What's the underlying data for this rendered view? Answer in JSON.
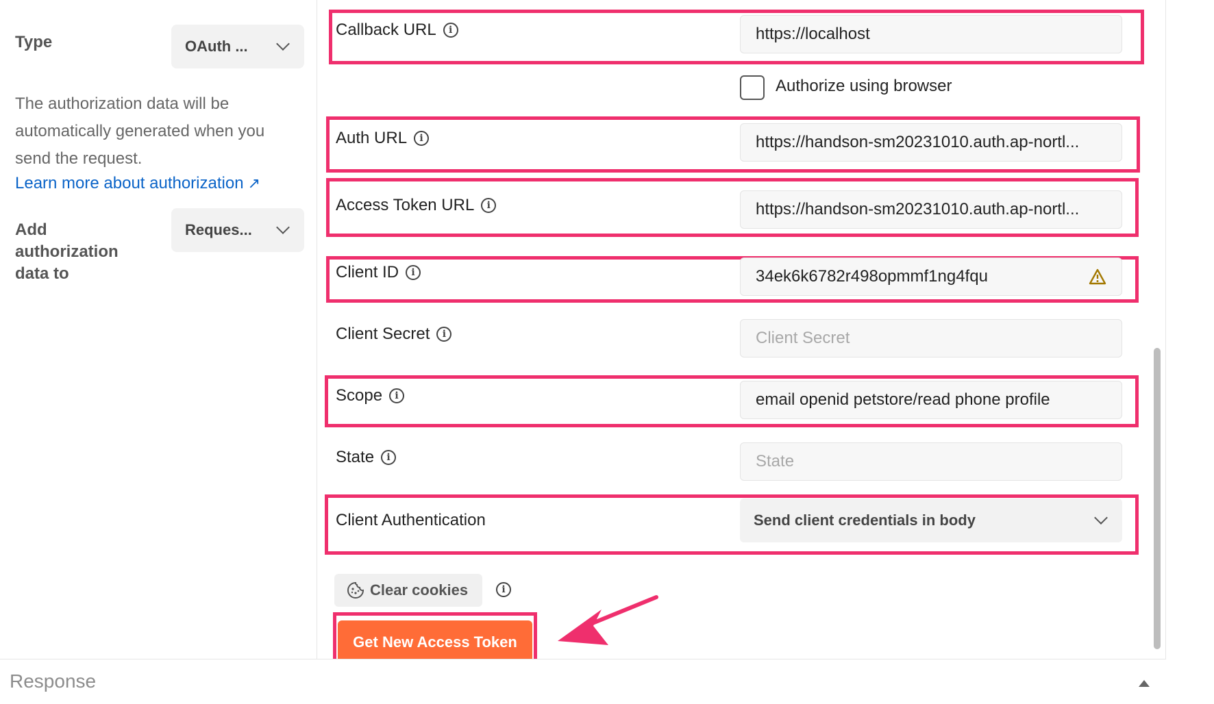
{
  "left": {
    "type_label": "Type",
    "type_value": "OAuth ...",
    "description": "The authorization data will be automatically generated when you send the request.",
    "learn_more": "Learn more about authorization",
    "learn_more_arrow": "↗",
    "add_label": "Add authorization data to",
    "add_value": "Reques..."
  },
  "fields": {
    "callback_url": {
      "label": "Callback URL",
      "value": "https://localhost"
    },
    "authorize_browser": "Authorize using browser",
    "auth_url": {
      "label": "Auth URL",
      "value": "https://handson-sm20231010.auth.ap-nortl..."
    },
    "access_token_url": {
      "label": "Access Token URL",
      "value": "https://handson-sm20231010.auth.ap-nortl..."
    },
    "client_id": {
      "label": "Client ID",
      "value": "34ek6k6782r498opmmf1ng4fqu"
    },
    "client_secret": {
      "label": "Client Secret",
      "placeholder": "Client Secret"
    },
    "scope": {
      "label": "Scope",
      "value": "email openid petstore/read phone profile"
    },
    "state": {
      "label": "State",
      "placeholder": "State"
    },
    "client_auth": {
      "label": "Client Authentication",
      "value": "Send client credentials in body"
    }
  },
  "actions": {
    "clear_cookies": "Clear cookies",
    "get_token": "Get New Access Token"
  },
  "bottom": {
    "response": "Response"
  },
  "colors": {
    "highlight": "#ef2f6d",
    "primary": "#ff6c37",
    "link": "#0b64c8"
  }
}
